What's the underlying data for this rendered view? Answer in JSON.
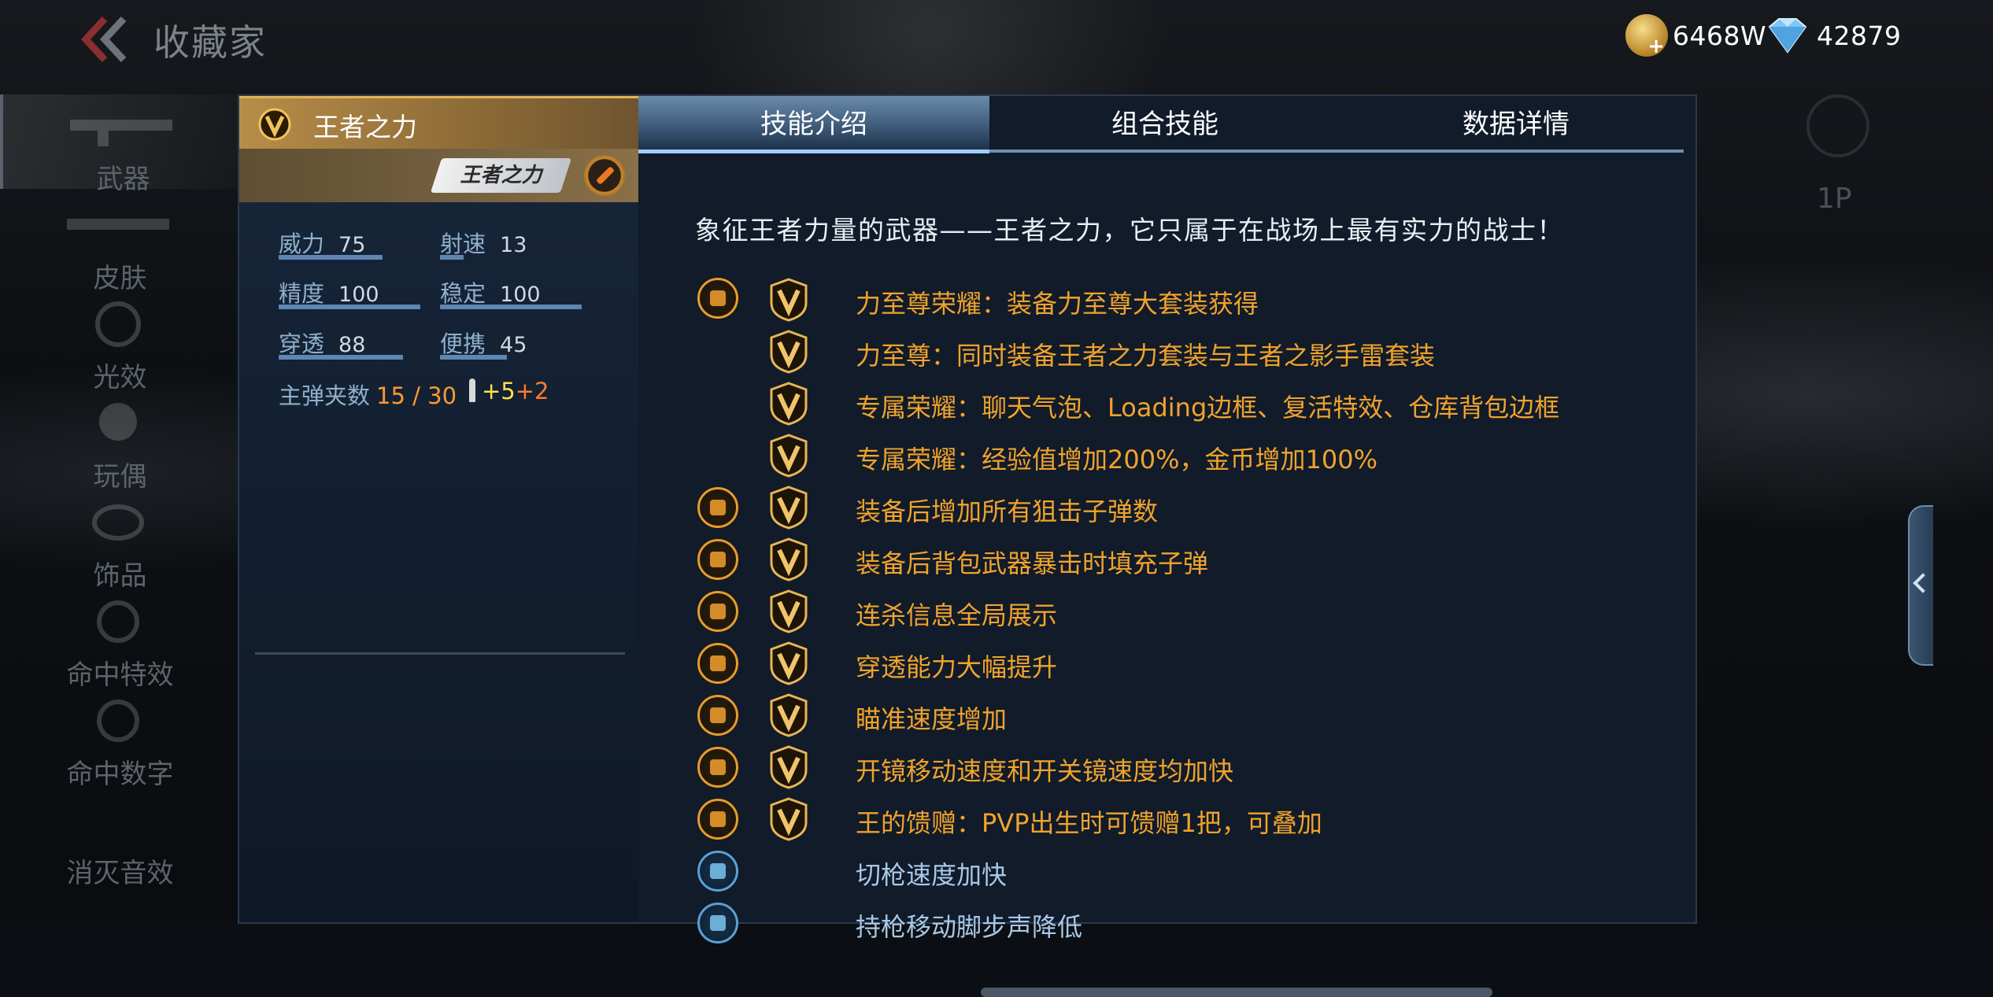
{
  "header": {
    "title": "收藏家",
    "gold": "6468W",
    "diamonds": "42879"
  },
  "sidebar": {
    "items": [
      {
        "label": "武器"
      },
      {
        "label": "皮肤"
      },
      {
        "label": "光效"
      },
      {
        "label": "玩偶"
      },
      {
        "label": "饰品"
      },
      {
        "label": "命中特效"
      },
      {
        "label": "命中数字"
      },
      {
        "label": "消灭音效"
      }
    ]
  },
  "right_rail": {
    "label": "1P"
  },
  "weapon": {
    "name": "王者之力",
    "logo_text": "王者之力",
    "stats": [
      {
        "label": "威力",
        "value": "75",
        "bar_fraction": 0.75
      },
      {
        "label": "射速",
        "value": "13",
        "bar_fraction": 0.13
      },
      {
        "label": "精度",
        "value": "100",
        "bar_fraction": 1.0
      },
      {
        "label": "稳定",
        "value": "100",
        "bar_fraction": 1.0
      },
      {
        "label": "穿透",
        "value": "88",
        "bar_fraction": 0.88
      },
      {
        "label": "便携",
        "value": "45",
        "bar_fraction": 0.45
      }
    ],
    "magazine_label": "主弹夹数",
    "magazine_value": "15 / 30",
    "ammo_bonus_yellow": "+5",
    "ammo_bonus_orange": "+2"
  },
  "tabs": [
    {
      "label": "技能介绍",
      "active": true
    },
    {
      "label": "组合技能",
      "active": false
    },
    {
      "label": "数据详情",
      "active": false
    }
  ],
  "description": "象征王者力量的武器——王者之力，它只属于在战场上最有实力的战士！",
  "skills": [
    {
      "text": "力至尊荣耀：装备力至尊大套装获得",
      "icon": "diamond-emblem-icon",
      "has_v": true,
      "color": "orange"
    },
    {
      "text": "力至尊：同时装备王者之力套装与王者之影手雷套装",
      "icon": null,
      "has_v": true,
      "color": "orange"
    },
    {
      "text": "专属荣耀：聊天气泡、Loading边框、复活特效、仓库背包边框",
      "icon": null,
      "has_v": true,
      "color": "orange"
    },
    {
      "text": "专属荣耀：经验值增加200%，金币增加100%",
      "icon": null,
      "has_v": true,
      "color": "orange"
    },
    {
      "text": "装备后增加所有狙击子弹数",
      "icon": "sniper-bullet-icon",
      "has_v": true,
      "color": "orange"
    },
    {
      "text": "装备后背包武器暴击时填充子弹",
      "icon": "backpack-refill-icon",
      "has_v": true,
      "color": "orange"
    },
    {
      "text": "连杀信息全局展示",
      "icon": "killstreak-banner-icon",
      "has_v": true,
      "color": "orange"
    },
    {
      "text": "穿透能力大幅提升",
      "icon": "penetration-icon",
      "has_v": true,
      "color": "orange"
    },
    {
      "text": "瞄准速度增加",
      "icon": "crosshair-icon",
      "has_v": true,
      "color": "orange"
    },
    {
      "text": "开镜移动速度和开关镜速度均加快",
      "icon": "scope-icon",
      "has_v": true,
      "color": "orange"
    },
    {
      "text": "王的馈赠：PVP出生时可馈赠1把，可叠加",
      "icon": "gift-icon",
      "has_v": true,
      "color": "orange"
    },
    {
      "text": "切枪速度加快",
      "icon": "weapon-swap-icon",
      "has_v": false,
      "color": "blue"
    },
    {
      "text": "持枪移动脚步声降低",
      "icon": "footstep-icon",
      "has_v": false,
      "color": "blue"
    }
  ]
}
